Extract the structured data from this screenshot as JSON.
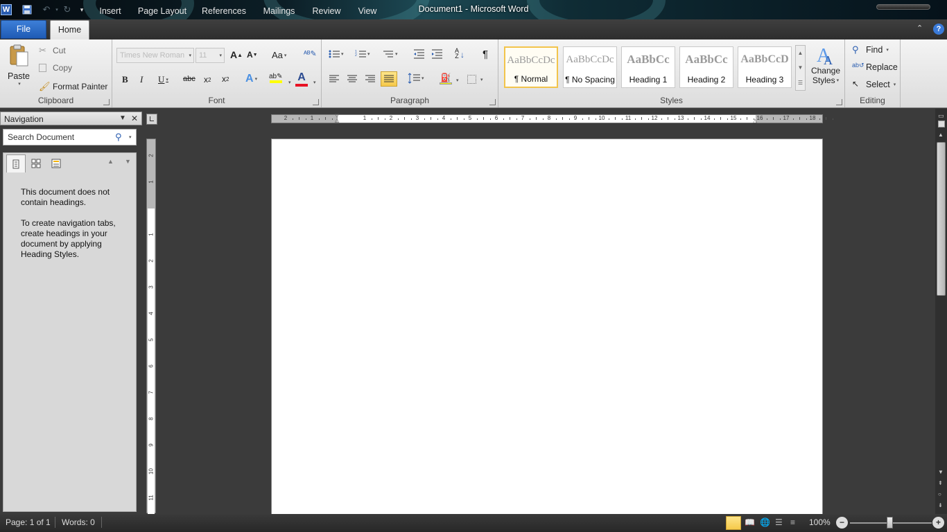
{
  "window": {
    "title": "Document1  -  Microsoft Word"
  },
  "tabs": [
    {
      "label": "File"
    },
    {
      "label": "Home"
    },
    {
      "label": "Insert"
    },
    {
      "label": "Page Layout"
    },
    {
      "label": "References"
    },
    {
      "label": "Mailings"
    },
    {
      "label": "Review"
    },
    {
      "label": "View"
    }
  ],
  "ribbon": {
    "clipboard": {
      "group": "Clipboard",
      "paste": "Paste",
      "cut": "Cut",
      "copy": "Copy",
      "format_painter": "Format Painter"
    },
    "font": {
      "group": "Font",
      "font_name": "Times New Roman",
      "font_size": "11"
    },
    "paragraph": {
      "group": "Paragraph"
    },
    "styles": {
      "group": "Styles",
      "gallery": [
        {
          "sample": "AaBbCcDc",
          "name": "¶ Normal"
        },
        {
          "sample": "AaBbCcDc",
          "name": "¶ No Spacing"
        },
        {
          "sample": "AaBbCc",
          "name": "Heading 1"
        },
        {
          "sample": "AaBbCc",
          "name": "Heading 2"
        },
        {
          "sample": "AaBbCcD",
          "name": "Heading 3"
        }
      ],
      "change_styles_1": "Change",
      "change_styles_2": "Styles"
    },
    "editing": {
      "group": "Editing",
      "find": "Find",
      "replace": "Replace",
      "select": "Select"
    }
  },
  "navigation": {
    "title": "Navigation",
    "search_placeholder": "Search Document",
    "message_1": "This document does not contain headings.",
    "message_2": "To create navigation tabs, create headings in your document by applying Heading Styles."
  },
  "ruler": {
    "labels": [
      "2",
      "1",
      "1",
      "2",
      "3",
      "4",
      "5",
      "6",
      "7",
      "8",
      "9",
      "10",
      "11",
      "12",
      "13",
      "14",
      "15",
      "16",
      "17",
      "18"
    ],
    "vlabels": [
      "2",
      "1",
      "1",
      "2",
      "3",
      "4",
      "5",
      "6",
      "7",
      "8",
      "9",
      "10",
      "11"
    ]
  },
  "statusbar": {
    "page": "Page: 1 of 1",
    "words": "Words: 0",
    "zoom": "100%"
  },
  "colors": {
    "accent": "#1f5bb5",
    "font_color": "#e81123",
    "highlight": "#ffff00"
  }
}
